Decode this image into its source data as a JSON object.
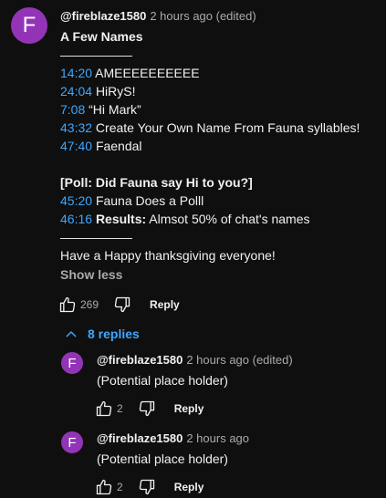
{
  "comment": {
    "avatar_letter": "F",
    "author": "@fireblaze1580",
    "meta": "2 hours ago (edited)",
    "lines": {
      "title": "A Few Names",
      "dash1": "——————",
      "ts1": "14:20",
      "text1": "AMEEEEEEEEEE",
      "ts2": "24:04",
      "text2": "HiRyS!",
      "ts3": "7:08",
      "text3": "“Hi Mark”",
      "ts4": "43:32",
      "text4": " Create Your Own Name From Fauna syllables!",
      "ts5": "47:40",
      "text5": "Faendal",
      "poll": "[Poll: Did Fauna say Hi to you?]",
      "ts6": "45:20",
      "text6": "Fauna Does a Polll",
      "ts7": "46:16",
      "results_label": "Results:",
      "text7": " Almsot 50% of chat's names",
      "dash2": "——————",
      "closing": "Have a Happy thanksgiving everyone!"
    },
    "show_less": "Show less",
    "likes": "269",
    "reply_label": "Reply"
  },
  "replies_toggle": "8 replies",
  "replies": [
    {
      "avatar_letter": "F",
      "author": "@fireblaze1580",
      "meta": "2 hours ago (edited)",
      "text": "(Potential place holder)",
      "likes": "2",
      "reply_label": "Reply"
    },
    {
      "avatar_letter": "F",
      "author": "@fireblaze1580",
      "meta": "2 hours ago",
      "text": "(Potential place holder)",
      "likes": "2",
      "reply_label": "Reply"
    }
  ],
  "colors": {
    "background": "#0f0f0f",
    "avatar": "#9334b7",
    "link": "#3ea6ff",
    "muted": "#aaaaaa",
    "text": "#f1f1f1"
  },
  "icons": [
    "like-icon",
    "dislike-icon",
    "chevron-up-icon"
  ]
}
